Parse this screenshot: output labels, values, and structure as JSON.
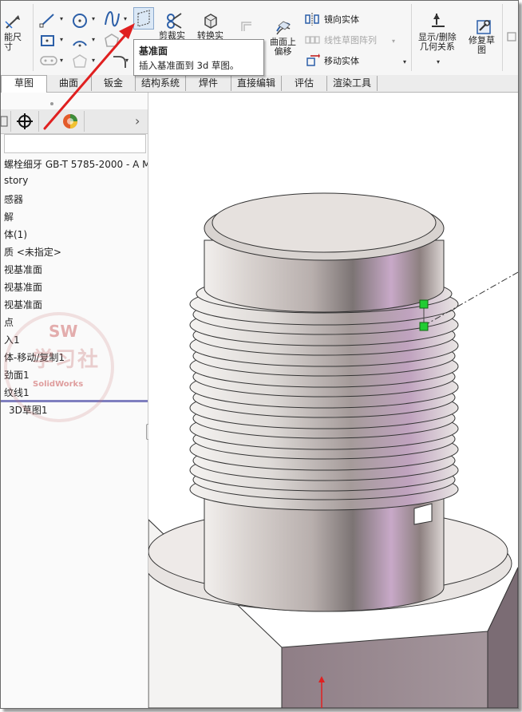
{
  "ribbon": {
    "smart_dim_label": "能尺\n寸",
    "trim_label": "剪裁实",
    "convert_label": "转换实",
    "offset_on_surface_label": "曲面上\n偏移",
    "mirror_label": "镜向实体",
    "linear_pattern_label": "线性草图阵列",
    "move_label": "移动实体",
    "relations_label": "显示/删除\n几何关系",
    "repair_label": "修复草\n图"
  },
  "tooltip": {
    "title": "基准面",
    "description": "插入基准面到 3d 草图。"
  },
  "tabs": [
    {
      "label": "草图",
      "active": true
    },
    {
      "label": "曲面"
    },
    {
      "label": "钣金"
    },
    {
      "label": "结构系统"
    },
    {
      "label": "焊件"
    },
    {
      "label": "直接编辑"
    },
    {
      "label": "评估"
    },
    {
      "label": "渲染工具"
    }
  ],
  "tree": {
    "root": "螺栓细牙 GB-T 5785-2000 - A M",
    "items": [
      "story",
      "感器",
      "解",
      "体(1)",
      "质 <未指定>",
      "视基准面",
      "视基准面",
      "视基准面",
      "点",
      "入1",
      "体-移动/复制1",
      "劲面1",
      "纹线1",
      "3D草图1"
    ]
  },
  "watermark": {
    "sw": "SW",
    "main": "学习社",
    "sub": "SolidWorks"
  },
  "colors": {
    "accent_red": "#e02020",
    "endpoint_green": "#22cc33",
    "tab_active_bg": "#ffffff"
  }
}
